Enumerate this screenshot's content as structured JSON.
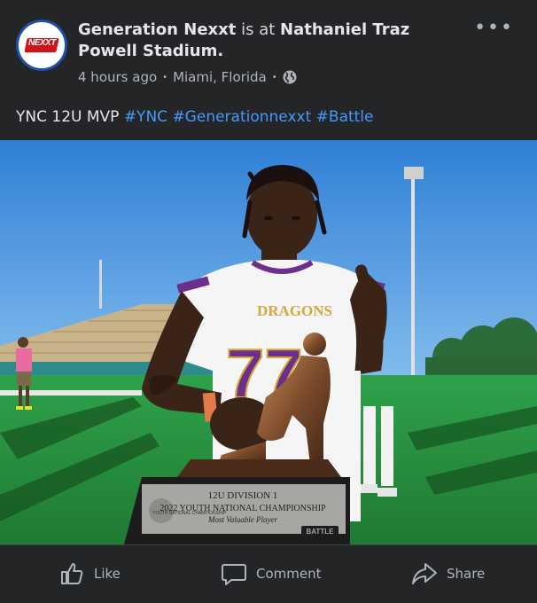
{
  "post": {
    "author": "Generation Nexxt",
    "connector": "is at",
    "location_name": "Nathaniel Traz Powell Stadium.",
    "time_ago": "4 hours ago",
    "place": "Miami, Florida",
    "privacy_icon": "globe-icon",
    "more_icon": "more-options-icon",
    "text": "YNC 12U MVP",
    "hashtags": [
      "#YNC",
      "#Generationnexxt",
      "#Battle"
    ]
  },
  "avatar": {
    "logo_text": "NEXXT"
  },
  "photo": {
    "jersey_team": "DRAGONS",
    "jersey_number": "77",
    "trophy_line1": "12U DIVISION 1",
    "trophy_line2": "2022 YOUTH NATIONAL CHAMPIONSHIP",
    "trophy_line3": "Most Valuable Player",
    "trophy_brand": "BATTLE",
    "trophy_seal": "YOUTH NATIONAL CHAMPIONSHIP"
  },
  "actions": {
    "like_label": "Like",
    "comment_label": "Comment",
    "share_label": "Share"
  },
  "colors": {
    "background": "#242526",
    "text": "#e4e6eb",
    "secondary_text": "#b0b3b8",
    "link": "#4599ff",
    "avatar_border": "#1f4fa8",
    "jersey_purple": "#6d2f8c",
    "jersey_gold": "#d4a73b"
  }
}
